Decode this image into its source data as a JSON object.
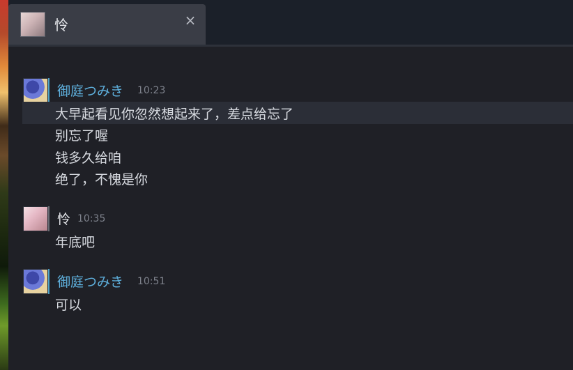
{
  "tab": {
    "title": "怜",
    "close_icon": "×"
  },
  "messages": [
    {
      "sender": "御庭つみき",
      "time": "10:23",
      "lines": [
        "大早起看见你忽然想起来了，差点给忘了",
        "别忘了喔",
        "钱多久给咱",
        "绝了，不愧是你"
      ]
    },
    {
      "sender": "怜",
      "time": "10:35",
      "lines": [
        "年底吧"
      ]
    },
    {
      "sender": "御庭つみき",
      "time": "10:51",
      "lines": [
        "可以"
      ]
    }
  ],
  "colors": {
    "accent_blue": "#5fb1de",
    "background": "#1f2026",
    "tab_bg": "#3a3d46"
  }
}
